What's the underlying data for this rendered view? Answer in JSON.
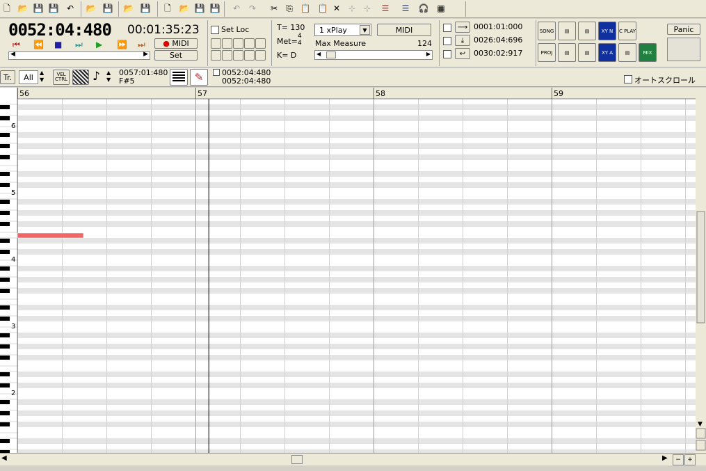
{
  "toolbar": {
    "icons": [
      "new-file",
      "open-file",
      "save-file",
      "save-as",
      "undo-arrow",
      "open-folder",
      "save-disk",
      "open-folder",
      "save-disk",
      "document",
      "open-folder",
      "save-disk",
      "save-disk",
      "undo",
      "redo",
      "cut",
      "copy",
      "paste",
      "paste-special",
      "delete",
      "select",
      "select-all",
      "list-red",
      "list-blue",
      "headphones",
      "grid"
    ]
  },
  "transport": {
    "position": "0052:04:480",
    "time": "00:01:35:23",
    "midi_label": "MIDI",
    "set_label": "Set",
    "set_loc_label": "Set Loc",
    "tempo": "T= 130",
    "meter_label": "Met=",
    "meter_num": "4",
    "meter_den": "4",
    "key": "K=  D",
    "play_mode": "1 xPlay",
    "midi_button": "MIDI",
    "max_measure_label": "Max Measure",
    "max_measure_value": "124",
    "loc1": "0001:01:000",
    "loc2": "0026:04:696",
    "loc3": "0030:02:917",
    "panic_label": "Panic",
    "panels": [
      "SONG",
      "PROJ",
      "XY N",
      "C PLAY",
      "XY A",
      "MIX"
    ]
  },
  "bar2": {
    "track_label": "Tr.",
    "all_label": "All",
    "vel_label": "VEL CTRL",
    "cursor_pos": "0057:01:480",
    "cursor_note": "F#5",
    "sel_start": "0052:04:480",
    "sel_end": "0052:04:480",
    "auto_scroll": "オートスクロール"
  },
  "ruler": {
    "measures": [
      "56",
      "57",
      "58",
      "59"
    ]
  },
  "octaves": [
    "6",
    "5",
    "4",
    "3",
    "2"
  ],
  "colors": {
    "pink": "#ee77cc",
    "violet": "#cc77dd",
    "blue": "#7777ee",
    "teal": "#66cccc",
    "tan": "#e0b890",
    "gray": "#a8a8a8",
    "olive": "#c0c080",
    "green": "#66c8a0",
    "red": "#ee6666",
    "cursor": "#000000"
  },
  "notes": [
    {
      "m": 56,
      "b": 0,
      "len": 1.5,
      "p": 64,
      "c": "red"
    }
  ]
}
